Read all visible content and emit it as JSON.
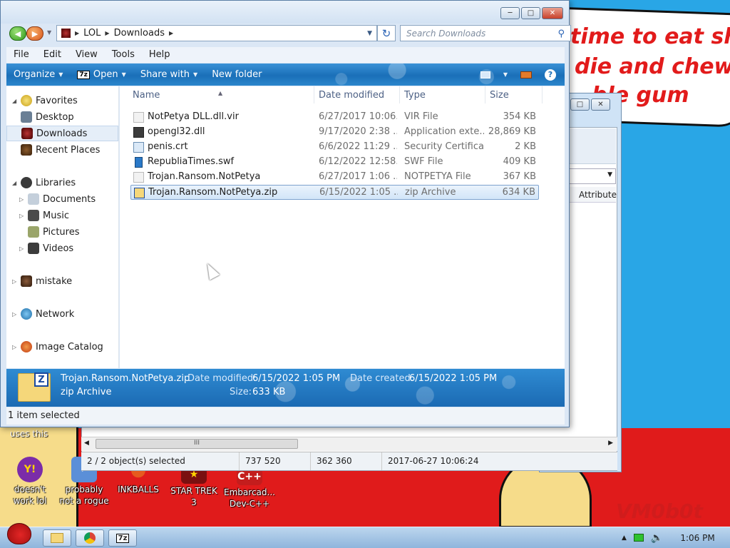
{
  "desktop": {
    "wallpaper_lines": [
      "time to eat shit",
      "die and chew",
      "ble gum"
    ],
    "signature": "VM0b0t",
    "uses_text": "uses this",
    "icons": [
      {
        "label": "doesn't work lol",
        "glyph": "Y!",
        "color": "#7b2ca8"
      },
      {
        "label": "probably not a rogue",
        "glyph": "✓",
        "color": "#5b8fd8"
      },
      {
        "label": "INKBALLS",
        "glyph": "●",
        "color": "#e65a1e"
      },
      {
        "label": "STAR TREK 3",
        "glyph": "★",
        "color": "#b51f1f"
      },
      {
        "label": "Embarcad... Dev-C++",
        "glyph": "C++",
        "color": "#c41d1d"
      }
    ]
  },
  "bg_window": {
    "column_header": "Attribute",
    "scroll_thumb": "III",
    "status": [
      "2 / 2 object(s) selected",
      "737 520",
      "362 360",
      "2017-06-27 10:06:24"
    ]
  },
  "explorer": {
    "address": {
      "segments": [
        "LOL",
        "Downloads"
      ]
    },
    "search_placeholder": "Search Downloads",
    "menu": [
      "File",
      "Edit",
      "View",
      "Tools",
      "Help"
    ],
    "toolbar": {
      "organize": "Organize",
      "open": "Open",
      "open_badge": "7z",
      "share": "Share with",
      "new_folder": "New folder"
    },
    "nav": {
      "favorites": "Favorites",
      "desktop": "Desktop",
      "downloads": "Downloads",
      "recent": "Recent Places",
      "libraries": "Libraries",
      "documents": "Documents",
      "music": "Music",
      "pictures": "Pictures",
      "videos": "Videos",
      "mistake": "mistake",
      "network": "Network",
      "image_catalog": "Image Catalog"
    },
    "columns": {
      "name": "Name",
      "date": "Date modified",
      "type": "Type",
      "size": "Size"
    },
    "files": [
      {
        "name": "NotPetya DLL.dll.vir",
        "date": "6/27/2017 10:06...",
        "type": "VIR File",
        "size": "354 KB",
        "icon": "#e8e8e8"
      },
      {
        "name": "opengl32.dll",
        "date": "9/17/2020 2:38 ...",
        "type": "Application exte...",
        "size": "28,869 KB",
        "icon": "#3c3c3c"
      },
      {
        "name": "penis.crt",
        "date": "6/6/2022 11:29 ...",
        "type": "Security Certifica...",
        "size": "2 KB",
        "icon": "#b9d4f0"
      },
      {
        "name": "RepubliaTimes.swf",
        "date": "6/12/2022 12:58...",
        "type": "SWF File",
        "size": "409 KB",
        "icon": "#2a79c8"
      },
      {
        "name": "Trojan.Ransom.NotPetya",
        "date": "6/27/2017 1:06 ...",
        "type": "NOTPETYA File",
        "size": "367 KB",
        "icon": "#e8e8e8"
      },
      {
        "name": "Trojan.Ransom.NotPetya.zip",
        "date": "6/15/2022 1:05 ...",
        "type": "zip Archive",
        "size": "634 KB",
        "icon": "#f5d77a"
      }
    ],
    "details": {
      "name": "Trojan.Ransom.NotPetya.zip",
      "type": "zip Archive",
      "modified_label": "Date modified:",
      "modified": "6/15/2022 1:05 PM",
      "created_label": "Date created:",
      "created": "6/15/2022 1:05 PM",
      "size_label": "Size:",
      "size": "633 KB"
    },
    "status": "1 item selected"
  },
  "taskbar": {
    "clock": "1:06 PM",
    "open_badge": "7z"
  }
}
